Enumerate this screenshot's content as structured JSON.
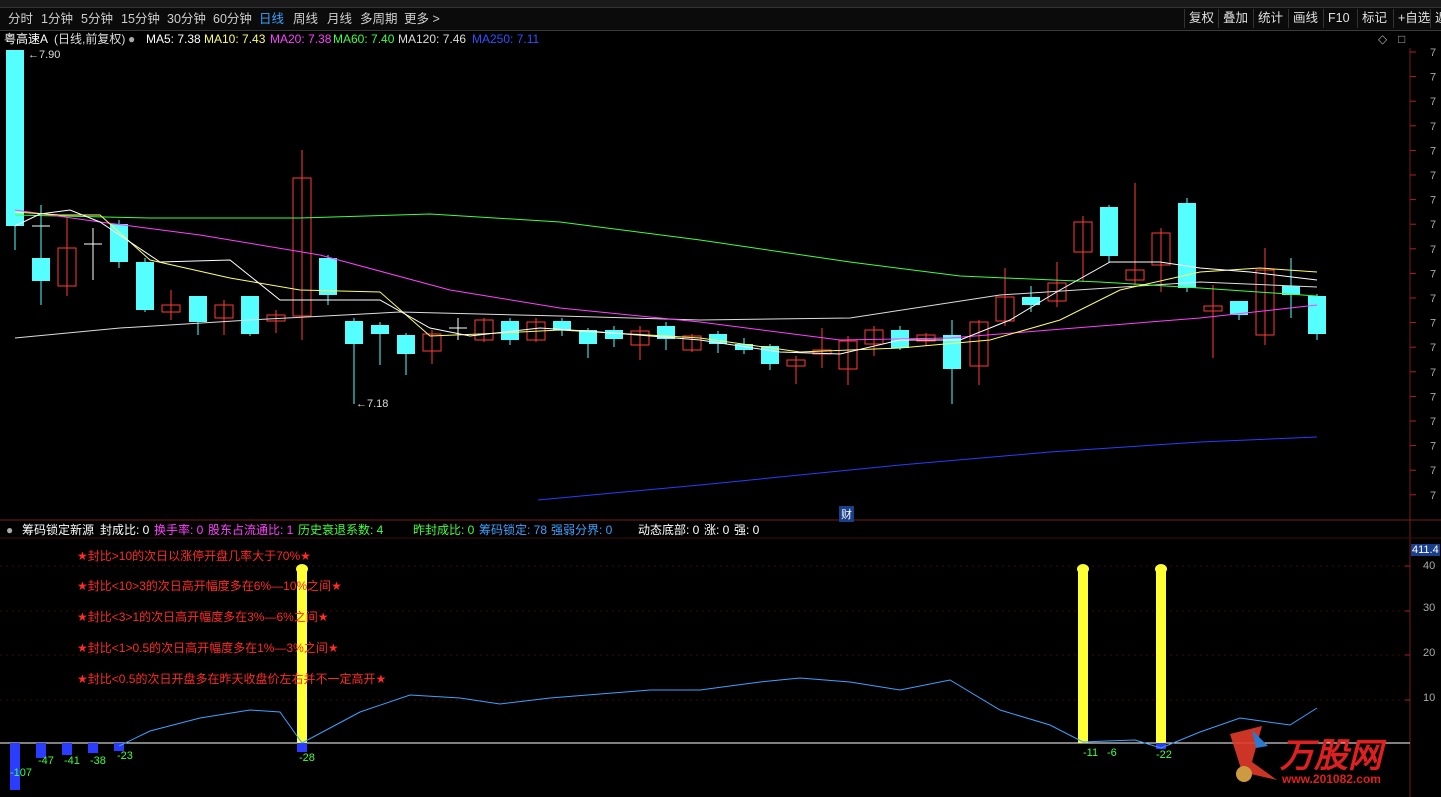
{
  "toolbar": {
    "periods": [
      "分时",
      "1分钟",
      "5分钟",
      "15分钟",
      "30分钟",
      "60分钟",
      "日线",
      "周线",
      "月线",
      "多周期",
      "更多 >"
    ],
    "active_period": "日线",
    "right_buttons": [
      "复权",
      "叠加",
      "统计",
      "画线",
      "F10",
      "标记",
      "+自选",
      "返"
    ]
  },
  "info": {
    "stock": "粤高速A",
    "mode": "(日线,前复权)",
    "ma": [
      {
        "label": "MA5: 7.38",
        "color": "#ffffff"
      },
      {
        "label": "MA10: 7.43",
        "color": "#ffff66"
      },
      {
        "label": "MA20: 7.38",
        "color": "#ff40ff"
      },
      {
        "label": "MA60: 7.40",
        "color": "#40ff40"
      },
      {
        "label": "MA120: 7.46",
        "color": "#dddddd"
      },
      {
        "label": "MA250: 7.11",
        "color": "#3050ff"
      }
    ]
  },
  "price_marks": {
    "high": "7.90",
    "low": "7.18",
    "cai": "财"
  },
  "indicator": {
    "name": "筹码锁定新源",
    "items": [
      {
        "label": "封成比: 0",
        "color": "#ffffff"
      },
      {
        "label": "换手率: 0",
        "color": "#ff40ff"
      },
      {
        "label": "股东占流通比: 1",
        "color": "#ff40ff"
      },
      {
        "label": "历史衰退系数: 4",
        "color": "#40ff40"
      },
      {
        "label": "昨封成比: 0",
        "color": "#40ff40"
      },
      {
        "label": "筹码锁定: 78",
        "color": "#3ea2ff"
      },
      {
        "label": "强弱分界: 0",
        "color": "#3ea2ff"
      },
      {
        "label": "动态底部: 0",
        "color": "#ffffff"
      },
      {
        "label": "涨: 0",
        "color": "#ffffff"
      },
      {
        "label": "强: 0",
        "color": "#ffffff"
      }
    ],
    "notes": [
      "★封比>10的次日以涨停开盘几率大于70%★",
      "★封比<10>3的次日高开幅度多在6%—10%之间★",
      "★封比<3>1的次日高开幅度多在3%—6%之间★",
      "★封比<1>0.5的次日高开幅度多在1%—3%之间★",
      "★封比<0.5的次日开盘多在昨天收盘价左右并不一定高开★"
    ],
    "axis_top": "411.4",
    "axis_ticks": [
      "40",
      "30",
      "20",
      "10"
    ],
    "bar_values": [
      "-107",
      "-47",
      "-41",
      "-38",
      "-23",
      "-28",
      "-11",
      "-6",
      "-22"
    ]
  },
  "watermark": {
    "brand": "万股网",
    "url": "www.201082.com"
  }
}
